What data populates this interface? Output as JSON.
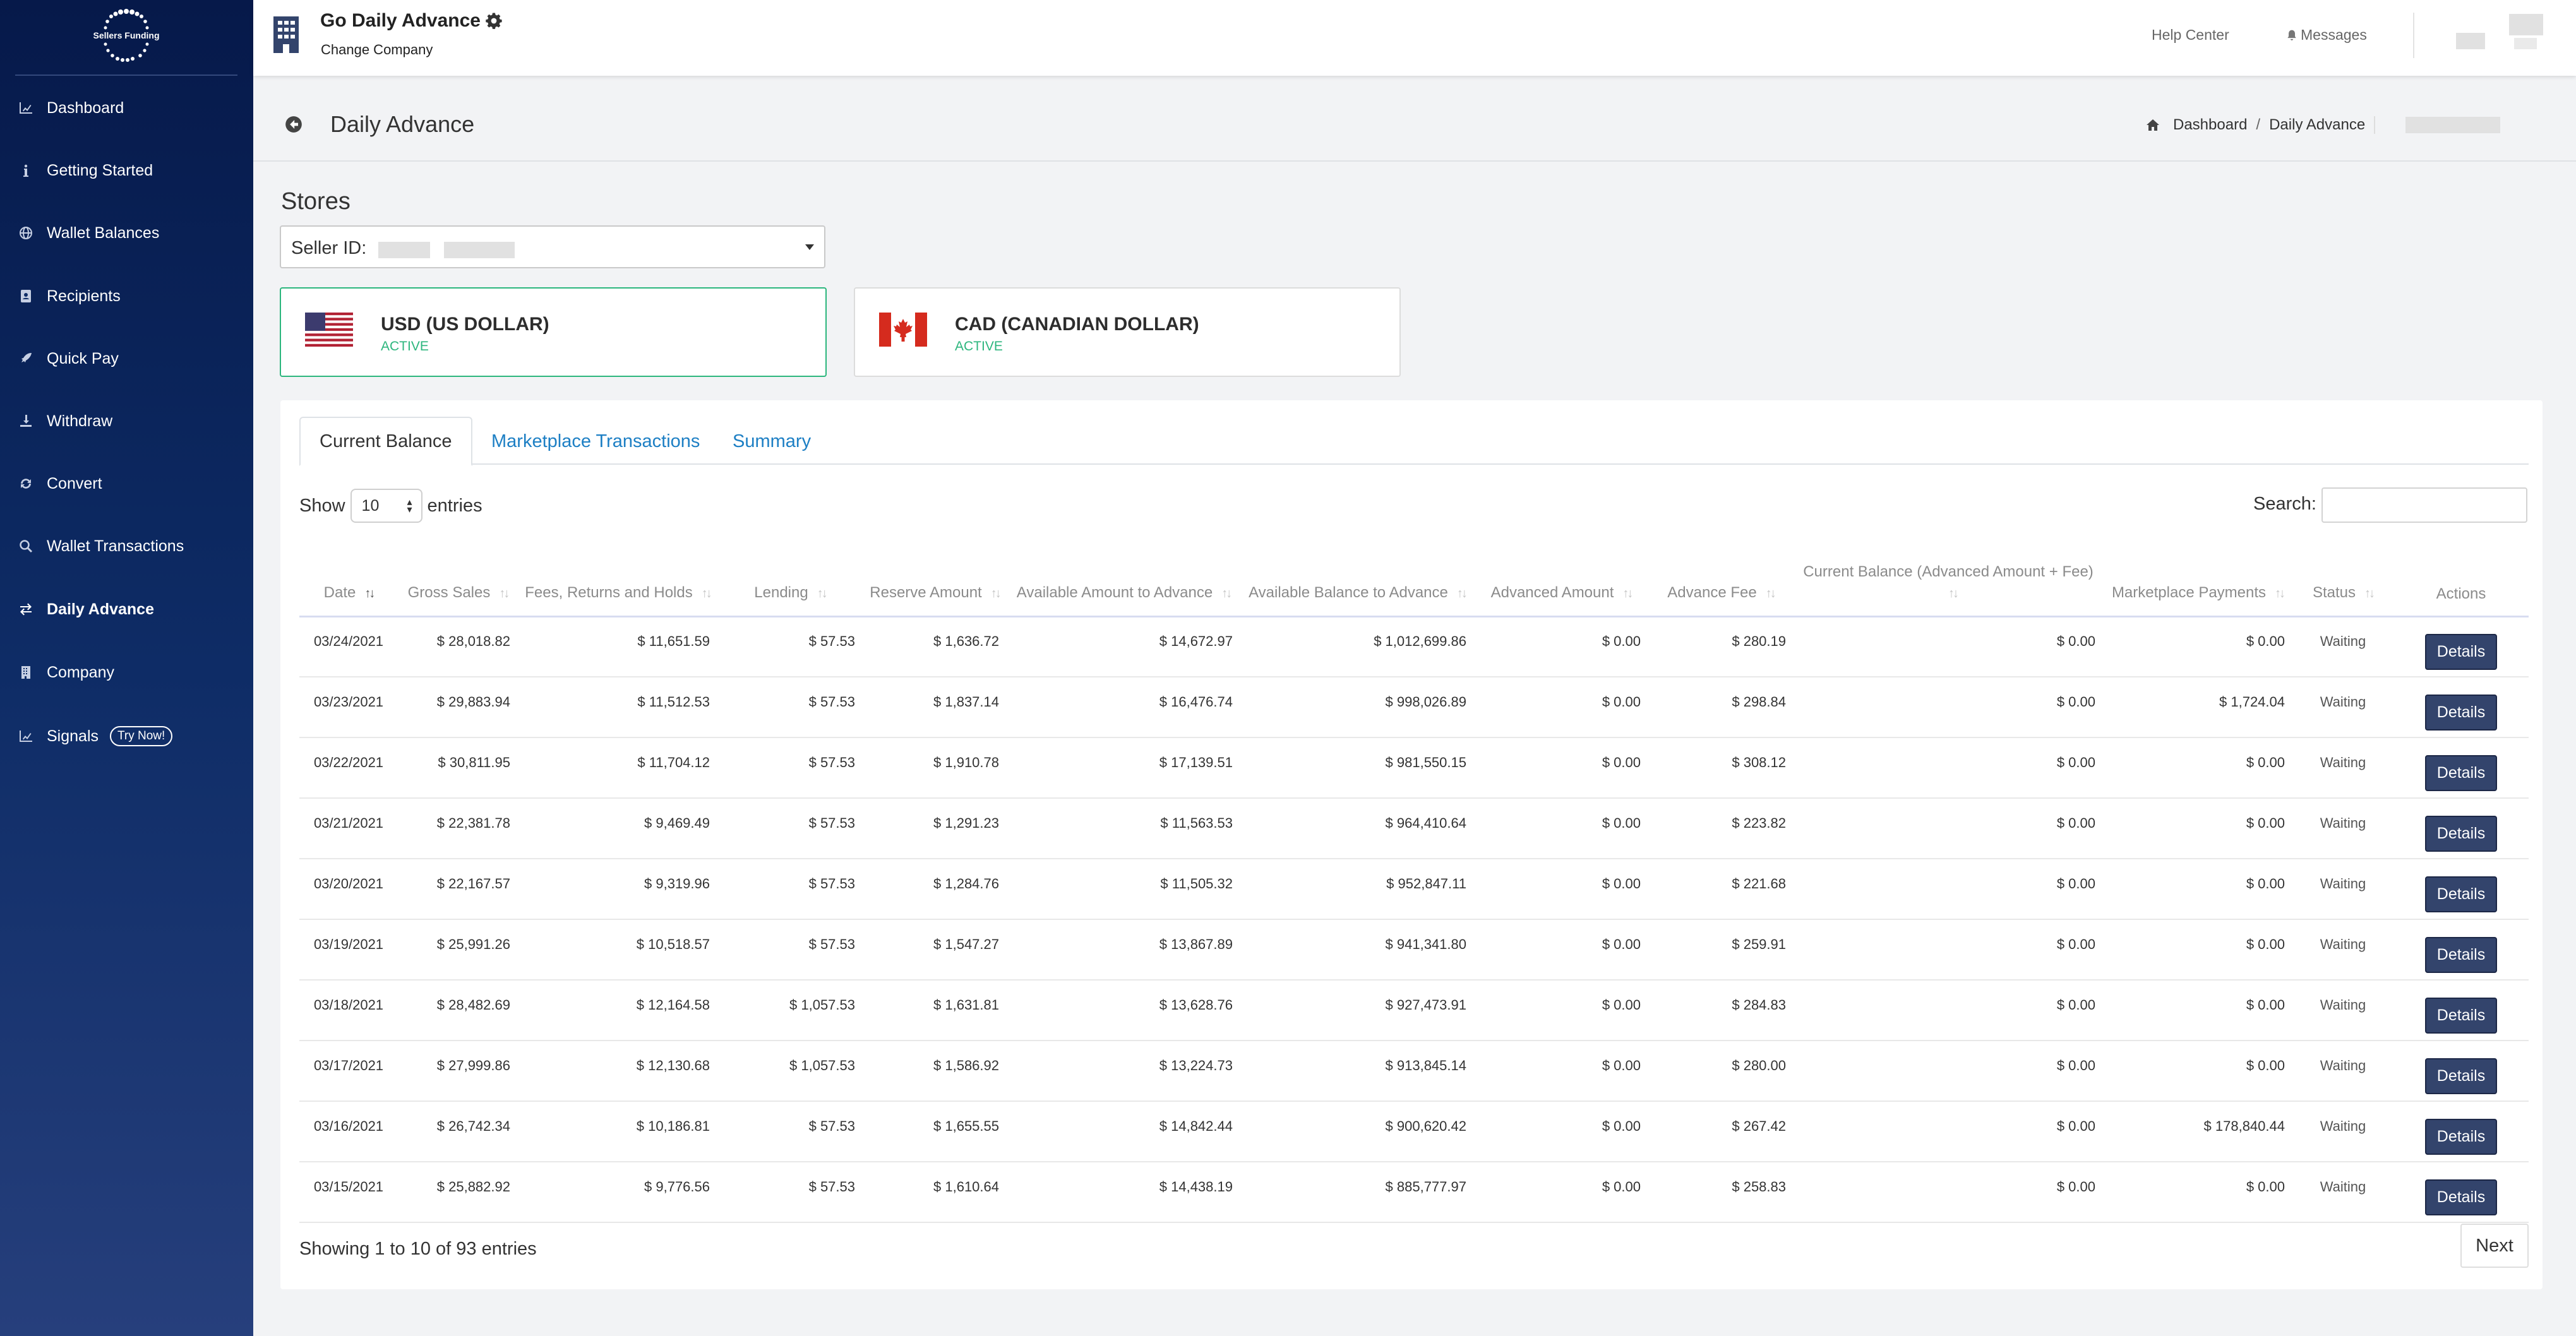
{
  "brand": {
    "logo_text": "Sellers Funding"
  },
  "sidebar": {
    "items": [
      {
        "label": "Dashboard",
        "icon": "chart-icon"
      },
      {
        "label": "Getting Started",
        "icon": "info-icon"
      },
      {
        "label": "Wallet Balances",
        "icon": "globe-icon"
      },
      {
        "label": "Recipients",
        "icon": "address-book-icon"
      },
      {
        "label": "Quick Pay",
        "icon": "rocket-icon"
      },
      {
        "label": "Withdraw",
        "icon": "withdraw-icon"
      },
      {
        "label": "Convert",
        "icon": "refresh-icon"
      },
      {
        "label": "Wallet Transactions",
        "icon": "search-icon"
      },
      {
        "label": "Daily Advance",
        "icon": "exchange-icon",
        "active": true
      },
      {
        "label": "Company",
        "icon": "building-icon"
      },
      {
        "label": "Signals",
        "icon": "chart-icon",
        "badge": "Try Now!"
      }
    ]
  },
  "topbar": {
    "company_name": "Go Daily Advance",
    "change_company": "Change Company",
    "help_center": "Help Center",
    "messages": "Messages"
  },
  "header": {
    "title": "Daily Advance",
    "breadcrumb": [
      "Dashboard",
      "Daily Advance"
    ],
    "breadcrumb_sep": "/"
  },
  "stores": {
    "title": "Stores",
    "seller_label": "Seller ID:"
  },
  "currencies": [
    {
      "name": "USD (US DOLLAR)",
      "status": "ACTIVE",
      "selected": true
    },
    {
      "name": "CAD (CANADIAN DOLLAR)",
      "status": "ACTIVE",
      "selected": false
    }
  ],
  "tabs": [
    "Current Balance",
    "Marketplace Transactions",
    "Summary"
  ],
  "table_controls": {
    "show": "Show",
    "entries_value": "10",
    "entries": "entries",
    "search_label": "Search:"
  },
  "table": {
    "headers": [
      "Date",
      "Gross Sales",
      "Fees, Returns and Holds",
      "Lending",
      "Reserve Amount",
      "Available Amount to Advance",
      "Available Balance to Advance",
      "Advanced Amount",
      "Advance Fee",
      "Current Balance (Advanced Amount + Fee)",
      "Marketplace Payments",
      "Status",
      "Actions"
    ],
    "action_label": "Details",
    "rows": [
      [
        "03/24/2021",
        "$ 28,018.82",
        "$ 11,651.59",
        "$ 57.53",
        "$ 1,636.72",
        "$ 14,672.97",
        "$ 1,012,699.86",
        "$ 0.00",
        "$ 280.19",
        "$ 0.00",
        "$ 0.00",
        "Waiting"
      ],
      [
        "03/23/2021",
        "$ 29,883.94",
        "$ 11,512.53",
        "$ 57.53",
        "$ 1,837.14",
        "$ 16,476.74",
        "$ 998,026.89",
        "$ 0.00",
        "$ 298.84",
        "$ 0.00",
        "$ 1,724.04",
        "Waiting"
      ],
      [
        "03/22/2021",
        "$ 30,811.95",
        "$ 11,704.12",
        "$ 57.53",
        "$ 1,910.78",
        "$ 17,139.51",
        "$ 981,550.15",
        "$ 0.00",
        "$ 308.12",
        "$ 0.00",
        "$ 0.00",
        "Waiting"
      ],
      [
        "03/21/2021",
        "$ 22,381.78",
        "$ 9,469.49",
        "$ 57.53",
        "$ 1,291.23",
        "$ 11,563.53",
        "$ 964,410.64",
        "$ 0.00",
        "$ 223.82",
        "$ 0.00",
        "$ 0.00",
        "Waiting"
      ],
      [
        "03/20/2021",
        "$ 22,167.57",
        "$ 9,319.96",
        "$ 57.53",
        "$ 1,284.76",
        "$ 11,505.32",
        "$ 952,847.11",
        "$ 0.00",
        "$ 221.68",
        "$ 0.00",
        "$ 0.00",
        "Waiting"
      ],
      [
        "03/19/2021",
        "$ 25,991.26",
        "$ 10,518.57",
        "$ 57.53",
        "$ 1,547.27",
        "$ 13,867.89",
        "$ 941,341.80",
        "$ 0.00",
        "$ 259.91",
        "$ 0.00",
        "$ 0.00",
        "Waiting"
      ],
      [
        "03/18/2021",
        "$ 28,482.69",
        "$ 12,164.58",
        "$ 1,057.53",
        "$ 1,631.81",
        "$ 13,628.76",
        "$ 927,473.91",
        "$ 0.00",
        "$ 284.83",
        "$ 0.00",
        "$ 0.00",
        "Waiting"
      ],
      [
        "03/17/2021",
        "$ 27,999.86",
        "$ 12,130.68",
        "$ 1,057.53",
        "$ 1,586.92",
        "$ 13,224.73",
        "$ 913,845.14",
        "$ 0.00",
        "$ 280.00",
        "$ 0.00",
        "$ 0.00",
        "Waiting"
      ],
      [
        "03/16/2021",
        "$ 26,742.34",
        "$ 10,186.81",
        "$ 57.53",
        "$ 1,655.55",
        "$ 14,842.44",
        "$ 900,620.42",
        "$ 0.00",
        "$ 267.42",
        "$ 0.00",
        "$ 178,840.44",
        "Waiting"
      ],
      [
        "03/15/2021",
        "$ 25,882.92",
        "$ 9,776.56",
        "$ 57.53",
        "$ 1,610.64",
        "$ 14,438.19",
        "$ 885,777.97",
        "$ 0.00",
        "$ 258.83",
        "$ 0.00",
        "$ 0.00",
        "Waiting"
      ]
    ]
  },
  "footer": {
    "showing": "Showing 1 to 10 of 93 entries",
    "next": "Next"
  },
  "colors": {
    "sidebar_top": "#06194a",
    "sidebar_bottom": "#263f7c",
    "accent_green": "#2cb67d",
    "link_blue": "#1d7fc4",
    "button_navy": "#33446c"
  }
}
